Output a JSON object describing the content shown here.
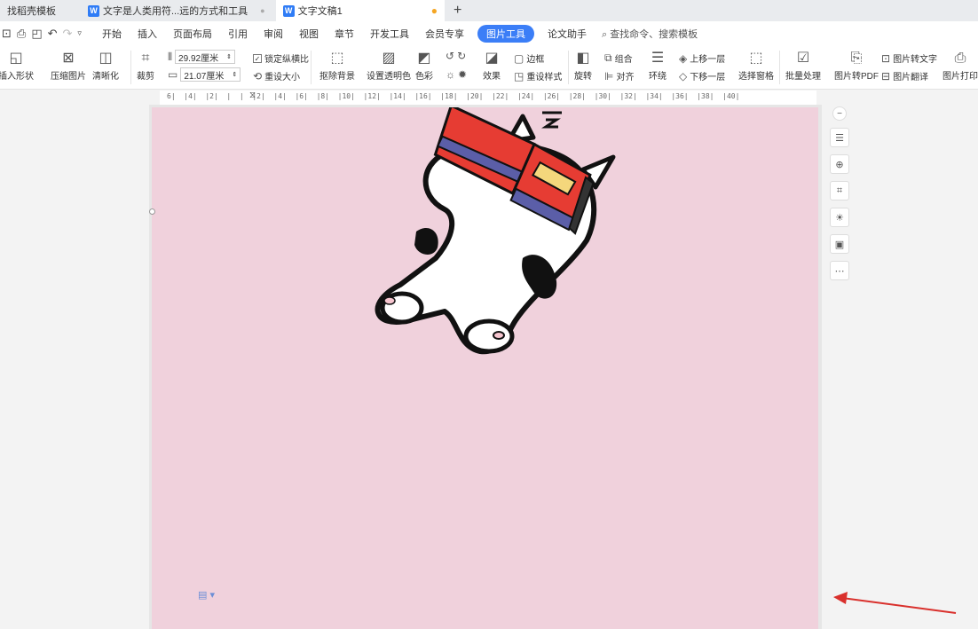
{
  "tabs": [
    {
      "label": "找稻壳模板"
    },
    {
      "label": "文字是人类用符...远的方式和工具",
      "close": "●"
    },
    {
      "label": "文字文稿1",
      "modified_dot": "●"
    }
  ],
  "new_tab": "+",
  "menu": {
    "items": [
      "开始",
      "插入",
      "页面布局",
      "引用",
      "审阅",
      "视图",
      "章节",
      "开发工具",
      "会员专享"
    ],
    "active": "图片工具",
    "after_active": [
      "论文助手"
    ],
    "search_placeholder": "查找命令、搜索模板"
  },
  "ribbon": {
    "insert_shape": "插入形状",
    "compress": "压缩图片",
    "sharpen": "清晰化",
    "crop": "裁剪",
    "height_value": "29.92厘米",
    "width_value": "21.07厘米",
    "lock_ratio": "锁定纵横比",
    "reset_size": "重设大小",
    "remove_bg": "抠除背景",
    "transparent": "设置透明色",
    "color": "色彩",
    "effects": "效果",
    "border": "边框",
    "reset_style": "重设样式",
    "rotate": "旋转",
    "group": "组合",
    "align": "对齐",
    "wrap": "环绕",
    "bring_forward": "上移一层",
    "send_backward": "下移一层",
    "selection_pane": "选择窗格",
    "batch": "批量处理",
    "to_pdf": "图片转PDF",
    "to_text": "图片转文字",
    "translate": "图片翻译",
    "print": "图片打印"
  },
  "ruler_text": "6|  |4|  |2|  |  |  |2|  |4|  |6|  |8|  |10|  |12|  |14|  |16|  |18|  |20|  |22|  |24|  |26|  |28|  |30|  |32|  |34|  |36|  |38|  |40|",
  "colors": {
    "page_bg": "#f0d1dc",
    "accent": "#3b7ef7",
    "arrow": "#d9302c"
  }
}
